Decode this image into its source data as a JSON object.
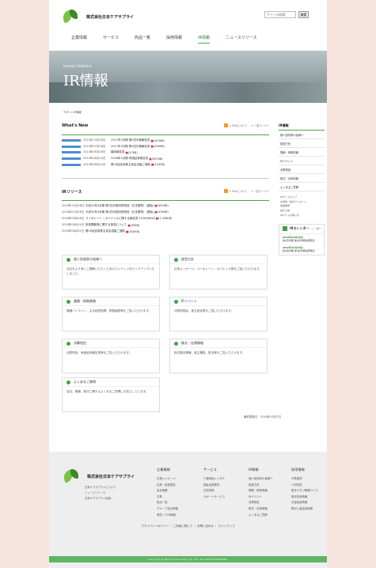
{
  "header": {
    "company": "株式会社日本ケアサプライ",
    "search_placeholder": "サイト内検索",
    "search_button": "検索",
    "nav": [
      "企業情報",
      "サービス",
      "商品一覧",
      "採用情報",
      "IR情報",
      "ニュースリリース"
    ],
    "nav_active_index": 4
  },
  "hero": {
    "subtitle": "Investor Relations",
    "title": "IR情報"
  },
  "breadcrumb": "TOP > IR情報",
  "whats_new": {
    "title": "What's New",
    "links": [
      "> RSSについて",
      "> 一覧ページへ"
    ],
    "items": [
      {
        "date": "2014年10月28日",
        "text": "2017年3月期 第2四半期報告書",
        "size": "(443KB)"
      },
      {
        "date": "2014年07月28日",
        "text": "2017年3月期 第1四半期報告書",
        "size": "(426KB)"
      },
      {
        "date": "2014年06月26日",
        "text": "臨時報告書",
        "size": "(17KB)"
      },
      {
        "date": "2014年06月24日",
        "text": "2016年3月期 有価証券報告書",
        "size": "(947KB)"
      },
      {
        "date": "2014年06月24日",
        "text": "第16回定時株主総会決議ご通知",
        "size": "(104KB)"
      }
    ]
  },
  "ir_release": {
    "title": "IRリリース",
    "links": [
      "> RSSについて",
      "> 一覧ページへ"
    ],
    "items": [
      {
        "date": "2016年10月28日",
        "text": "平成29年3月期 第2四半期決算短信〔日本基準〕(連結)",
        "size": "(550KB)"
      },
      {
        "date": "2016年07月28日",
        "text": "平成29年3月期 第1四半期決算短信〔日本基準〕(連結)",
        "size": "(476KB)"
      },
      {
        "date": "2016年06月28日",
        "text": "コーポレート・ガバナンスに関する報告書 2016/06/28",
        "size": "(1,348KB)"
      },
      {
        "date": "2016年06月24日",
        "text": "役員異動等に関する事項について",
        "size": "(39KB)"
      },
      {
        "date": "2016年06月01日",
        "text": "第16回定時株主総会招集ご通知",
        "size": "(500KB)"
      }
    ]
  },
  "cards": [
    {
      "title": "個人投資家の皆様へ",
      "body": "当社をより深くご理解いただくためのコンテンツをピックアップいたしました。"
    },
    {
      "title": "経営方針",
      "body": "社長メッセージ、コーポレート・ガバナンス等をご覧いただけます。"
    },
    {
      "title": "業績・財務情報",
      "body": "業績ハイライト、主な経営指標、財務諸表等をご覧いただけます。"
    },
    {
      "title": "IRイベント",
      "body": "決算説明会、株主総会等をご覧いただけます。"
    },
    {
      "title": "決算短信",
      "body": "決算短信、有価証券報告書等をご覧いただけます。"
    },
    {
      "title": "株式・社債情報",
      "body": "株式基本情報、株主構成、配当等をご覧いただけます。"
    },
    {
      "title": "よくあるご質問",
      "body": "会社、業績、株式に関するよくあるご質問にお答えしています。"
    }
  ],
  "updated": "最終更新日：2016年10月7日",
  "sidebar": {
    "title": "IR情報",
    "items": [
      "個人投資家の皆様へ",
      "経営方針",
      "業績・財務情報",
      "IRイベント",
      "決算短信",
      "株式・社債情報",
      "よくあるご質問"
    ],
    "small_items": [
      "IRサイトマップ",
      "IR資料一括ダウンロード",
      "免責事項",
      "電子公告",
      "IRサイトの使い方"
    ],
    "calendar": {
      "title": "IRカレンダー",
      "more": "> 一覧へ",
      "events": [
        {
          "date": "2016年10月28日",
          "text": "第2四半期 第2四半期決算発表"
        },
        {
          "date": "2016年12月28日",
          "text": "第3四半期 第3四半期決算発表"
        }
      ]
    }
  },
  "footer": {
    "company": "株式会社日本ケアサプライ",
    "links": [
      "日本ケアサプライについて",
      "ニュースリリース",
      "日本ケアサプライ採用"
    ],
    "columns": [
      {
        "title": "企業情報",
        "items": [
          "社長メッセージ",
          "社是・経営理念",
          "会社概要",
          "沿革",
          "拠点一覧",
          "グループ会社情報",
          "環境・CSR情報"
        ]
      },
      {
        "title": "サービス",
        "items": [
          "介護用品レンタル",
          "福祉用具販売",
          "住宅改修",
          "サポートサービス"
        ]
      },
      {
        "title": "IR情報",
        "items": [
          "個人投資家の皆様へ",
          "経営方針",
          "業績・財務情報",
          "IRイベント",
          "決算短信",
          "株式・社債情報",
          "よくあるご質問"
        ]
      },
      {
        "title": "採用情報",
        "items": [
          "代表挨拶",
          "人材育成",
          "働きやすい職場づくり",
          "新卒採用情報",
          "中途採用情報",
          "障がい者採用情報"
        ]
      }
    ],
    "bottom_links": [
      "プライバシーポリシー",
      "ご利用に際して",
      "お問い合わせ",
      "サイトマップ"
    ],
    "copyright": "Copyright (C) Nippon Care Supply Co., Ltd. ALL RIGHTS RESERVED."
  }
}
